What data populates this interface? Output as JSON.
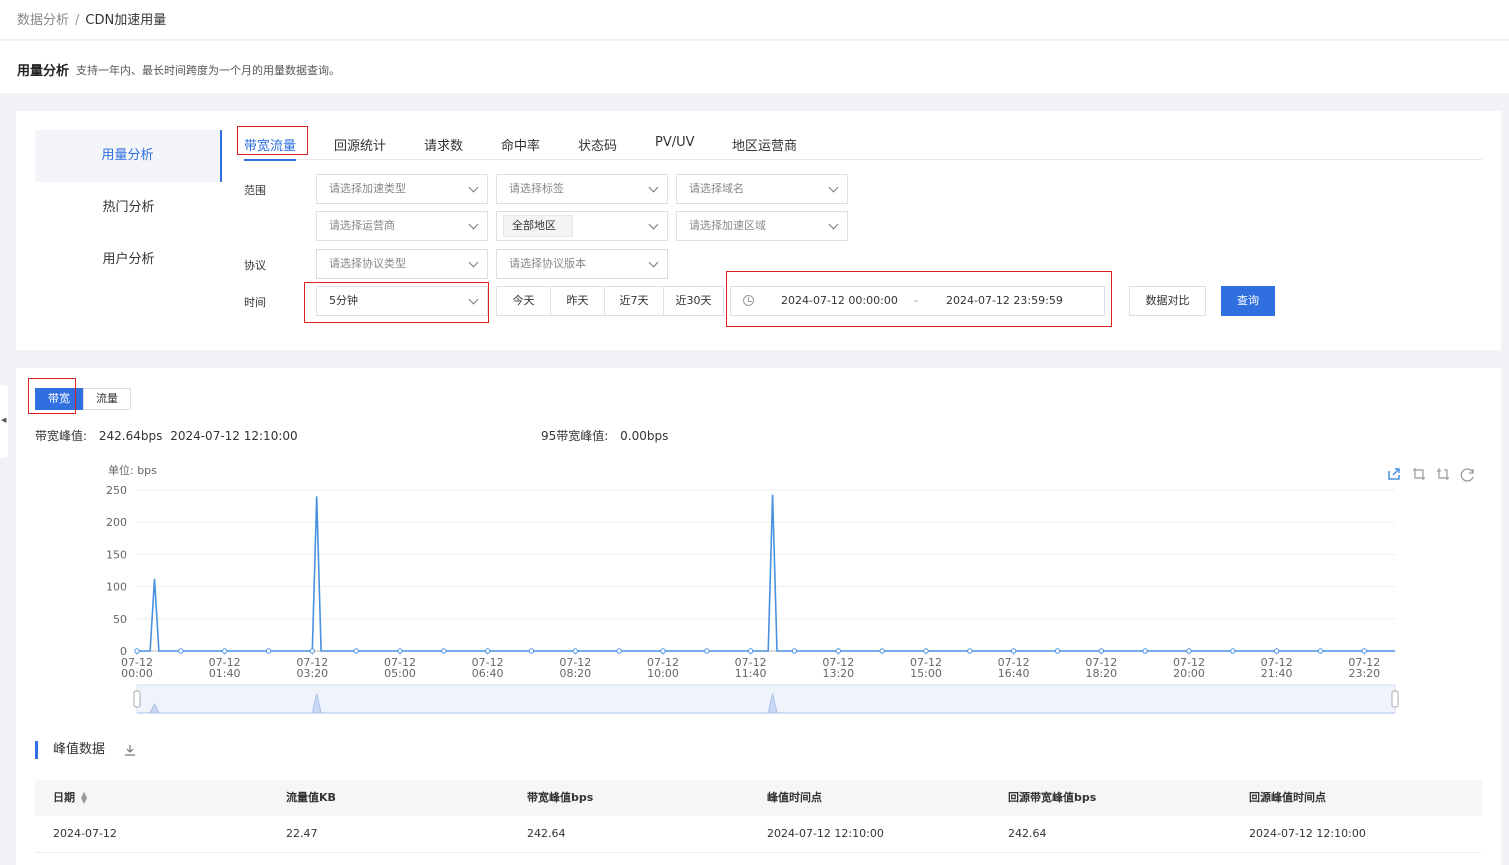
{
  "breadcrumb": {
    "parent": "数据分析",
    "separator": "/",
    "current": "CDN加速用量"
  },
  "intro": {
    "title": "用量分析",
    "description": "支持一年内、最长时间跨度为一个月的用量数据查询。"
  },
  "sidebar": {
    "items": [
      {
        "label": "用量分析",
        "active": true
      },
      {
        "label": "热门分析"
      },
      {
        "label": "用户分析"
      }
    ]
  },
  "tabs": [
    {
      "label": "带宽流量",
      "active": true
    },
    {
      "label": "回源统计"
    },
    {
      "label": "请求数"
    },
    {
      "label": "命中率"
    },
    {
      "label": "状态码"
    },
    {
      "label": "PV/UV"
    },
    {
      "label": "地区运营商"
    }
  ],
  "filters": {
    "range_label": "范围",
    "accel_type": "请选择加速类型",
    "tag": "请选择标签",
    "domain": "请选择域名",
    "isp": "请选择运营商",
    "region_tag": "全部地区",
    "accel_region": "请选择加速区域",
    "protocol_label": "协议",
    "protocol_type": "请选择协议类型",
    "protocol_version": "请选择协议版本",
    "time_label": "时间",
    "granularity": "5分钟",
    "quick": [
      "今天",
      "昨天",
      "近7天",
      "近30天"
    ],
    "date_start": "2024-07-12 00:00:00",
    "date_sep": "-",
    "date_end": "2024-07-12 23:59:59",
    "compare_button": "数据对比",
    "query_button": "查询"
  },
  "metric_toggle": {
    "bandwidth": "带宽",
    "traffic": "流量"
  },
  "stats": {
    "peak_label": "带宽峰值:",
    "peak_value": "242.64bps",
    "peak_time": "2024-07-12 12:10:00",
    "p95_label": "95带宽峰值:",
    "p95_value": "0.00bps"
  },
  "chart_data": {
    "type": "line",
    "unit_label": "单位: bps",
    "ylim": [
      0,
      250
    ],
    "yticks": [
      0,
      50,
      100,
      150,
      200,
      250
    ],
    "x_tick_labels": [
      [
        "07-12",
        "00:00"
      ],
      [
        "07-12",
        "01:40"
      ],
      [
        "07-12",
        "03:20"
      ],
      [
        "07-12",
        "05:00"
      ],
      [
        "07-12",
        "06:40"
      ],
      [
        "07-12",
        "08:20"
      ],
      [
        "07-12",
        "10:00"
      ],
      [
        "07-12",
        "11:40"
      ],
      [
        "07-12",
        "13:20"
      ],
      [
        "07-12",
        "15:00"
      ],
      [
        "07-12",
        "16:40"
      ],
      [
        "07-12",
        "18:20"
      ],
      [
        "07-12",
        "20:00"
      ],
      [
        "07-12",
        "21:40"
      ],
      [
        "07-12",
        "23:20"
      ]
    ],
    "x_minutes_range": [
      0,
      1435
    ],
    "series": [
      {
        "points": [
          [
            0,
            0
          ],
          [
            15,
            0
          ],
          [
            20,
            112
          ],
          [
            25,
            0
          ],
          [
            60,
            0
          ],
          [
            195,
            0
          ],
          [
            200,
            0
          ],
          [
            205,
            240
          ],
          [
            210,
            0
          ],
          [
            245,
            0
          ],
          [
            715,
            0
          ],
          [
            720,
            0
          ],
          [
            725,
            242.64
          ],
          [
            730,
            0
          ],
          [
            1435,
            0
          ]
        ]
      }
    ],
    "color": "#4a90e2",
    "grid": true
  },
  "toolbox": [
    "share-icon",
    "zoom-select-icon",
    "zoom-reset-icon",
    "refresh-icon"
  ],
  "peak_section": {
    "title": "峰值数据"
  },
  "table": {
    "columns": [
      "日期",
      "流量值KB",
      "带宽峰值bps",
      "峰值时间点",
      "回源带宽峰值bps",
      "回源峰值时间点"
    ],
    "rows": [
      [
        "2024-07-12",
        "22.47",
        "242.64",
        "2024-07-12 12:10:00",
        "242.64",
        "2024-07-12 12:10:00"
      ]
    ]
  }
}
